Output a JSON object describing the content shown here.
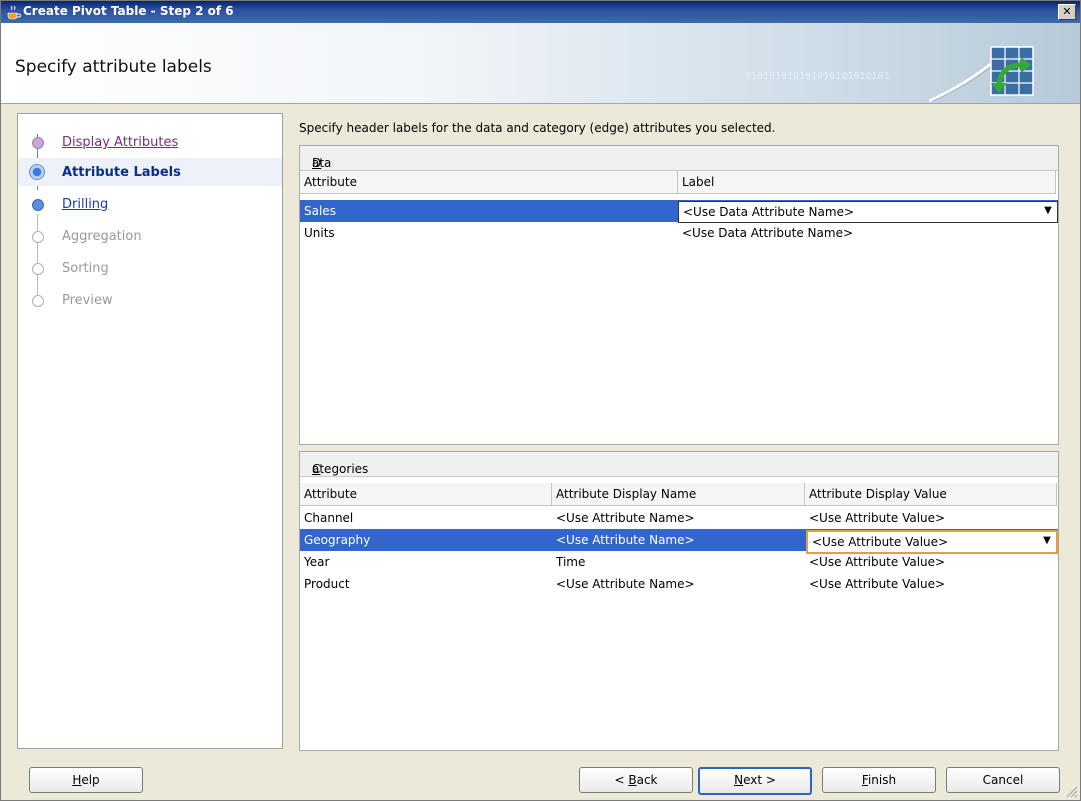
{
  "window": {
    "title": "Create Pivot Table - Step 2 of 6",
    "close_label": "✕"
  },
  "banner": {
    "title": "Specify attribute labels",
    "bits": "010101010101010101010101",
    "graphic_icon": "pivot-table-icon"
  },
  "nav": {
    "items": [
      {
        "label": "Display Attributes",
        "state": "visited"
      },
      {
        "label": "Attribute Labels",
        "state": "active"
      },
      {
        "label": "Drilling",
        "state": "link"
      },
      {
        "label": "Aggregation",
        "state": "disabled"
      },
      {
        "label": "Sorting",
        "state": "disabled"
      },
      {
        "label": "Preview",
        "state": "disabled"
      }
    ]
  },
  "main": {
    "intro": "Specify header labels for the data and category (edge) attributes you selected.",
    "data_values": {
      "title_mnemonic": "D",
      "title_rest": "ata Values",
      "columns": [
        "Attribute",
        "Label"
      ],
      "rows": [
        {
          "attribute": "Sales",
          "label": "<Use Data Attribute Name>",
          "selected": true
        },
        {
          "attribute": "Units",
          "label": "<Use Data Attribute Name>",
          "selected": false
        }
      ]
    },
    "categories": {
      "title_mnemonic": "C",
      "title_rest": "ategories",
      "columns": [
        "Attribute",
        "Attribute Display Name",
        "Attribute Display Value"
      ],
      "rows": [
        {
          "attribute": "Channel",
          "display_name": "<Use Attribute Name>",
          "display_value": "<Use Attribute Value>",
          "selected": false
        },
        {
          "attribute": "Geography",
          "display_name": "<Use Attribute Name>",
          "display_value": "<Use Attribute Value>",
          "selected": true
        },
        {
          "attribute": "Year",
          "display_name": "Time",
          "display_value": "<Use Attribute Value>",
          "selected": false
        },
        {
          "attribute": "Product",
          "display_name": "<Use Attribute Name>",
          "display_value": "<Use Attribute Value>",
          "selected": false
        }
      ]
    }
  },
  "buttons": {
    "help": {
      "mn": "H",
      "rest": "elp"
    },
    "back": {
      "pre": "< ",
      "mn": "B",
      "rest": "ack"
    },
    "next": {
      "mn": "N",
      "rest": "ext >"
    },
    "finish": {
      "mn": "F",
      "rest": "inish"
    },
    "cancel": "Cancel"
  },
  "colors": {
    "selection": "#3366cc",
    "nav_active_text": "#0b2e86",
    "nav_link": "#1a3ea6",
    "nav_visited": "#7a2a8a",
    "nav_disabled": "#9a9a9a"
  }
}
